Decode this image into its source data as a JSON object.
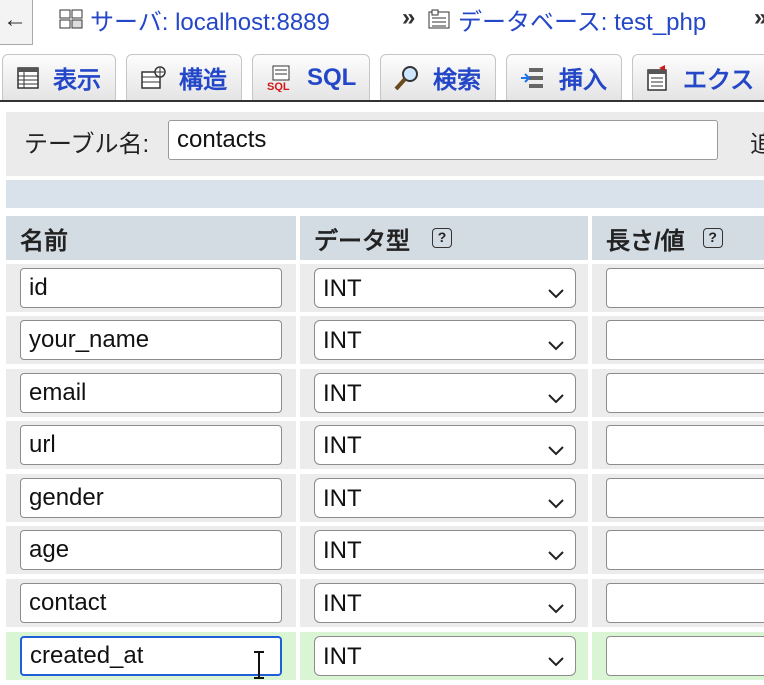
{
  "breadcrumb": {
    "back": "←",
    "server_label": "サーバ: localhost:8889",
    "separator": "»",
    "db_label": "データベース: test_php",
    "trailing": "»"
  },
  "tabs": [
    {
      "label": "表示",
      "icon": "table-browse-icon"
    },
    {
      "label": "構造",
      "icon": "structure-icon"
    },
    {
      "label": "SQL",
      "icon": "sql-icon"
    },
    {
      "label": "検索",
      "icon": "magnifier-icon"
    },
    {
      "label": "挿入",
      "icon": "insert-icon"
    },
    {
      "label": "エクス",
      "icon": "export-icon"
    }
  ],
  "table_name": {
    "label": "テーブル名:",
    "value": "contacts",
    "next_label": "追"
  },
  "columns_header": {
    "name": "名前",
    "type": "データ型",
    "length": "長さ/値",
    "help": "?"
  },
  "rows": [
    {
      "name": "id",
      "type": "INT"
    },
    {
      "name": "your_name",
      "type": "INT"
    },
    {
      "name": "email",
      "type": "INT"
    },
    {
      "name": "url",
      "type": "INT"
    },
    {
      "name": "gender",
      "type": "INT"
    },
    {
      "name": "age",
      "type": "INT"
    },
    {
      "name": "contact",
      "type": "INT"
    },
    {
      "name": "created_at",
      "type": "INT"
    }
  ],
  "colors": {
    "link": "#2447c8",
    "focus": "#1f60d8",
    "highlight_row": "#d9f5d4"
  }
}
